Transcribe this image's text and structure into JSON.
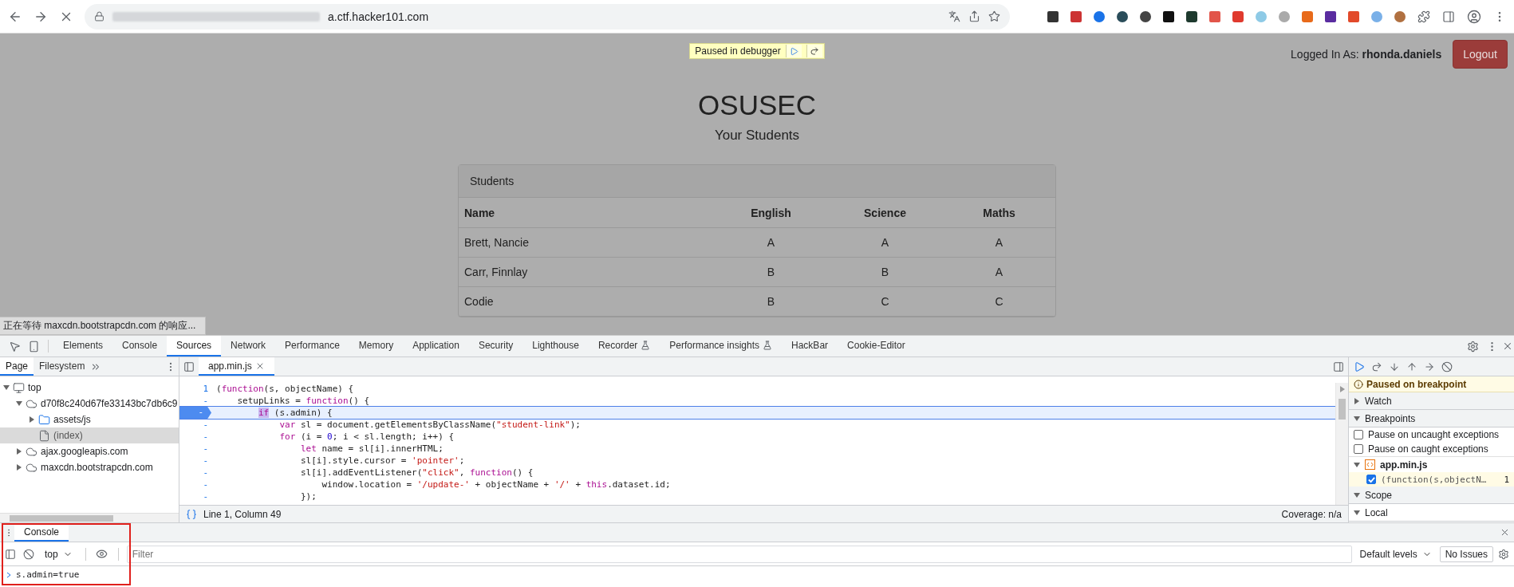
{
  "browser": {
    "url": "a.ctf.hacker101.com"
  },
  "page": {
    "debugger_banner": "Paused in debugger",
    "login_label": "Logged In As:",
    "username": "rhonda.daniels",
    "logout": "Logout",
    "title": "OSUSEC",
    "subtitle": "Your Students",
    "panel_heading": "Students",
    "columns": [
      "Name",
      "English",
      "Science",
      "Maths"
    ],
    "rows": [
      [
        "Brett, Nancie",
        "A",
        "A",
        "A"
      ],
      [
        "Carr, Finnlay",
        "B",
        "B",
        "A"
      ],
      [
        "Codie",
        "B",
        "C",
        "C"
      ]
    ],
    "status_text": "正在等待 maxcdn.bootstrapcdn.com 的响应..."
  },
  "devtools": {
    "tabs": [
      {
        "label": "Elements",
        "selected": false,
        "experimental": false
      },
      {
        "label": "Console",
        "selected": false,
        "experimental": false
      },
      {
        "label": "Sources",
        "selected": true,
        "experimental": false
      },
      {
        "label": "Network",
        "selected": false,
        "experimental": false
      },
      {
        "label": "Performance",
        "selected": false,
        "experimental": false
      },
      {
        "label": "Memory",
        "selected": false,
        "experimental": false
      },
      {
        "label": "Application",
        "selected": false,
        "experimental": false
      },
      {
        "label": "Security",
        "selected": false,
        "experimental": false
      },
      {
        "label": "Lighthouse",
        "selected": false,
        "experimental": false
      },
      {
        "label": "Recorder",
        "selected": false,
        "experimental": true
      },
      {
        "label": "Performance insights",
        "selected": false,
        "experimental": true
      },
      {
        "label": "HackBar",
        "selected": false,
        "experimental": false
      },
      {
        "label": "Cookie-Editor",
        "selected": false,
        "experimental": false
      }
    ]
  },
  "navigator": {
    "tabs": [
      {
        "label": "Page",
        "selected": true
      },
      {
        "label": "Filesystem",
        "selected": false
      }
    ],
    "tree": [
      {
        "label": "top",
        "kind": "frame",
        "expanded": true,
        "selected": false,
        "children": [
          {
            "label": "d70f8c240d67fe33143bc7db6c9",
            "kind": "origin",
            "expanded": true,
            "selected": false,
            "children": [
              {
                "label": "assets/js",
                "kind": "folder",
                "expanded": false,
                "selected": false
              },
              {
                "label": "(index)",
                "kind": "file",
                "selected": true
              }
            ]
          },
          {
            "label": "ajax.googleapis.com",
            "kind": "origin",
            "expanded": false,
            "selected": false
          },
          {
            "label": "maxcdn.bootstrapcdn.com",
            "kind": "origin",
            "expanded": false,
            "selected": false
          }
        ]
      }
    ]
  },
  "editor": {
    "file_tab": "app.min.js",
    "cursor_position": "Line 1, Column 49",
    "coverage": "Coverage: n/a",
    "lines": [
      {
        "gutter": "1",
        "paused": false,
        "tokens": [
          {
            "kind": "plain",
            "t": "("
          },
          {
            "kind": "keyword",
            "t": "function"
          },
          {
            "kind": "plain",
            "t": "(s, objectName) {"
          }
        ]
      },
      {
        "gutter": "-",
        "paused": false,
        "tokens": [
          {
            "kind": "plain",
            "t": "    setupLinks = "
          },
          {
            "kind": "keyword",
            "t": "function"
          },
          {
            "kind": "plain",
            "t": "() {"
          }
        ]
      },
      {
        "gutter": "-",
        "paused": true,
        "tokens": [
          {
            "kind": "current",
            "t": "        if"
          },
          {
            "kind": "plain",
            "t": " (s.admin) {"
          }
        ]
      },
      {
        "gutter": "-",
        "paused": false,
        "tokens": [
          {
            "kind": "keyword",
            "t": "            var"
          },
          {
            "kind": "plain",
            "t": " sl = document.getElementsByClassName("
          },
          {
            "kind": "string",
            "t": "\"student-link\""
          },
          {
            "kind": "plain",
            "t": ");"
          }
        ]
      },
      {
        "gutter": "-",
        "paused": false,
        "tokens": [
          {
            "kind": "keyword",
            "t": "            for"
          },
          {
            "kind": "plain",
            "t": " (i = "
          },
          {
            "kind": "number",
            "t": "0"
          },
          {
            "kind": "plain",
            "t": "; i < sl.length; i++) {"
          }
        ]
      },
      {
        "gutter": "-",
        "paused": false,
        "tokens": [
          {
            "kind": "keyword",
            "t": "                let"
          },
          {
            "kind": "plain",
            "t": " name = sl[i].innerHTML;"
          }
        ]
      },
      {
        "gutter": "-",
        "paused": false,
        "tokens": [
          {
            "kind": "plain",
            "t": "                sl[i].style.cursor = "
          },
          {
            "kind": "string",
            "t": "'pointer'"
          },
          {
            "kind": "plain",
            "t": ";"
          }
        ]
      },
      {
        "gutter": "-",
        "paused": false,
        "tokens": [
          {
            "kind": "plain",
            "t": "                sl[i].addEventListener("
          },
          {
            "kind": "string",
            "t": "\"click\""
          },
          {
            "kind": "plain",
            "t": ", "
          },
          {
            "kind": "keyword",
            "t": "function"
          },
          {
            "kind": "plain",
            "t": "() {"
          }
        ]
      },
      {
        "gutter": "-",
        "paused": false,
        "tokens": [
          {
            "kind": "plain",
            "t": "                    window.location = "
          },
          {
            "kind": "string",
            "t": "'/update-'"
          },
          {
            "kind": "plain",
            "t": " + objectName + "
          },
          {
            "kind": "string",
            "t": "'/'"
          },
          {
            "kind": "plain",
            "t": " + "
          },
          {
            "kind": "keyword",
            "t": "this"
          },
          {
            "kind": "plain",
            "t": ".dataset.id;"
          }
        ]
      },
      {
        "gutter": "-",
        "paused": false,
        "tokens": [
          {
            "kind": "plain",
            "t": "                });"
          }
        ]
      }
    ]
  },
  "debugger": {
    "paused_message": "Paused on breakpoint",
    "sections": [
      {
        "title": "Watch",
        "expanded": false
      },
      {
        "title": "Breakpoints",
        "expanded": true,
        "options": [
          {
            "label": "Pause on uncaught exceptions",
            "checked": false
          },
          {
            "label": "Pause on caught exceptions",
            "checked": false
          }
        ],
        "files": [
          {
            "name": "app.min.js",
            "breakpoints": [
              {
                "code": "(function(s,objectN…",
                "line": "1",
                "checked": true
              }
            ]
          }
        ]
      },
      {
        "title": "Scope",
        "expanded": true,
        "children": [
          {
            "title": "Local",
            "expanded": true
          }
        ]
      }
    ]
  },
  "console": {
    "tab": {
      "label": "Console",
      "selected": true
    },
    "context": "top",
    "filter_placeholder": "Filter",
    "levels": "Default levels",
    "issues": "No Issues",
    "input": "s.admin=true"
  }
}
